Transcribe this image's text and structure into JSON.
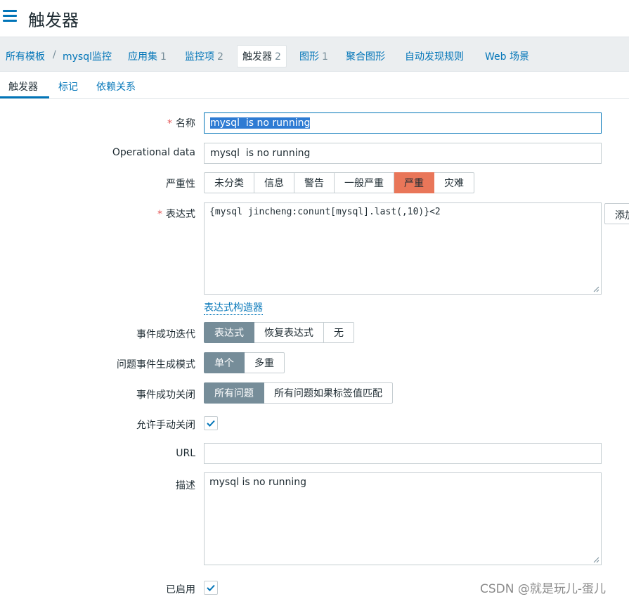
{
  "header": {
    "title": "触发器",
    "menu_icon": "hamburger-menu-icon"
  },
  "breadcrumb": {
    "items": [
      {
        "label": "所有模板",
        "count": ""
      },
      {
        "label": "mysql监控",
        "count": ""
      },
      {
        "label": "应用集",
        "count": "1"
      },
      {
        "label": "监控项",
        "count": "2"
      },
      {
        "label": "触发器",
        "count": "2"
      },
      {
        "label": "图形",
        "count": "1"
      },
      {
        "label": "聚合图形",
        "count": ""
      },
      {
        "label": "自动发现规则",
        "count": ""
      },
      {
        "label": "Web 场景",
        "count": ""
      }
    ],
    "separator": "/"
  },
  "tabs": [
    "触发器",
    "标记",
    "依赖关系"
  ],
  "form": {
    "name": {
      "label": "名称",
      "required_mark": "*",
      "value": "mysql  is no running"
    },
    "opdata": {
      "label": "Operational data",
      "value": "mysql  is no running"
    },
    "severity": {
      "label": "严重性",
      "options": [
        "未分类",
        "信息",
        "警告",
        "一般严重",
        "严重",
        "灾难"
      ],
      "selected": "严重"
    },
    "expression": {
      "label": "表达式",
      "required_mark": "*",
      "value": "{mysql jincheng:conunt[mysql].last(,10)}<2",
      "add_label": "添加",
      "builder_link": "表达式构造器"
    },
    "ok_event_gen": {
      "label": "事件成功迭代",
      "options": [
        "表达式",
        "恢复表达式",
        "无"
      ],
      "selected": "表达式"
    },
    "problem_mode": {
      "label": "问题事件生成模式",
      "options": [
        "单个",
        "多重"
      ],
      "selected": "单个"
    },
    "ok_close": {
      "label": "事件成功关闭",
      "options": [
        "所有问题",
        "所有问题如果标签值匹配"
      ],
      "selected": "所有问题"
    },
    "manual_close": {
      "label": "允许手动关闭",
      "checked": true
    },
    "url": {
      "label": "URL",
      "value": ""
    },
    "description": {
      "label": "描述",
      "value": "mysql  is no running"
    },
    "enabled": {
      "label": "已启用",
      "checked": true
    }
  },
  "watermark": "CSDN @就是玩儿-蛋儿",
  "colors": {
    "accent": "#0275b8",
    "severity_high": "#e97659",
    "selected_gray": "#768d99"
  }
}
